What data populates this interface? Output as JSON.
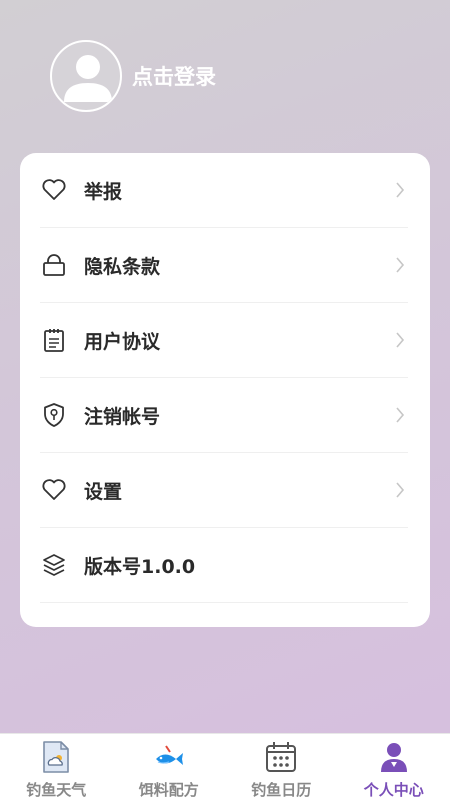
{
  "profile": {
    "login_text": "点击登录"
  },
  "menu": {
    "items": [
      {
        "label": "举报",
        "icon": "heart-icon"
      },
      {
        "label": "隐私条款",
        "icon": "lock-icon"
      },
      {
        "label": "用户协议",
        "icon": "clipboard-icon"
      },
      {
        "label": "注销帐号",
        "icon": "shield-key-icon"
      },
      {
        "label": "设置",
        "icon": "heart-icon"
      },
      {
        "label": "版本号1.0.0",
        "icon": "layers-icon"
      }
    ]
  },
  "tabbar": {
    "tabs": [
      {
        "label": "钓鱼天气",
        "icon": "weather-file-icon"
      },
      {
        "label": "饵料配方",
        "icon": "fish-icon"
      },
      {
        "label": "钓鱼日历",
        "icon": "calendar-icon"
      },
      {
        "label": "个人中心",
        "icon": "person-icon"
      }
    ],
    "active_index": 3
  },
  "colors": {
    "accent": "#7a4fb8",
    "fish": "#1e90e8",
    "text": "#2a2a2a"
  }
}
